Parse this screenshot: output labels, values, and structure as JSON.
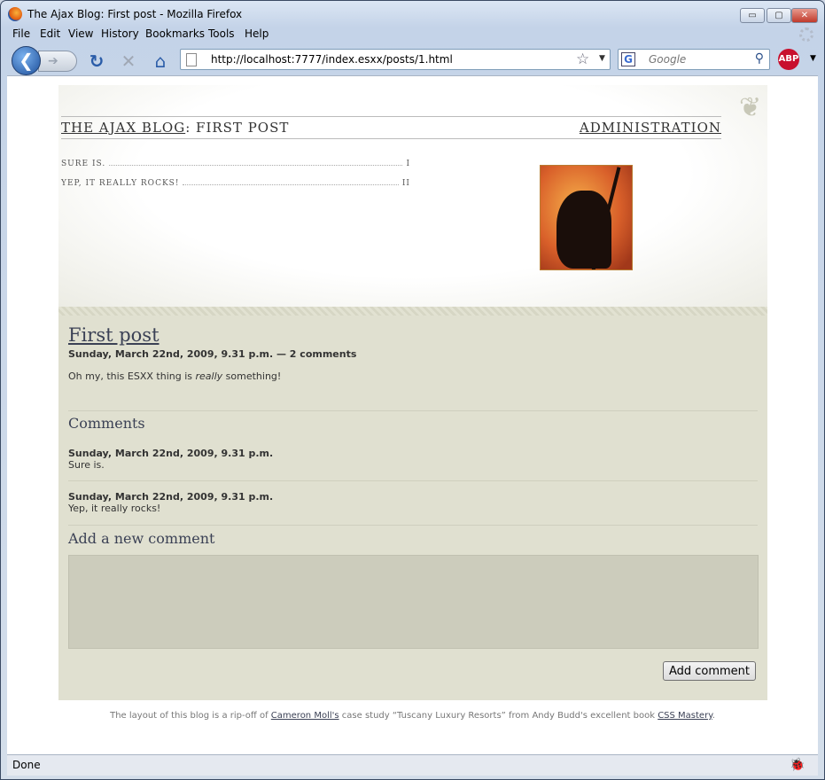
{
  "window": {
    "title": "The Ajax Blog: First post - Mozilla Firefox",
    "controls": {
      "minimize": "▭",
      "maximize": "▢",
      "close": "✕"
    }
  },
  "menu": [
    "File",
    "Edit",
    "View",
    "History",
    "Bookmarks",
    "Tools",
    "Help"
  ],
  "toolbar": {
    "url": "http://localhost:7777/index.esxx/posts/1.html",
    "search_placeholder": "Google",
    "abp_label": "ABP",
    "icons": [
      "back-icon",
      "forward-icon",
      "reload-icon",
      "stop-icon",
      "home-icon",
      "bookmark-star-icon",
      "search-icon"
    ]
  },
  "page": {
    "blog_title": "THE AJAX BLOG",
    "title_sep": ": ",
    "current_section": "FIRST POST",
    "admin_link": "ADMINISTRATION",
    "toc": [
      {
        "label": "SURE IS.",
        "num": "I"
      },
      {
        "label": "YEP, IT REALLY ROCKS!",
        "num": "II"
      }
    ],
    "post": {
      "title": "First post",
      "meta": "Sunday, March 22nd, 2009, 9.31 p.m. — 2 comments",
      "body_before": "Oh my, this ESXX thing is ",
      "body_em": "really",
      "body_after": " something!"
    },
    "comments_heading": "Comments",
    "comments": [
      {
        "date": "Sunday, March 22nd, 2009, 9.31 p.m.",
        "text": "Sure is."
      },
      {
        "date": "Sunday, March 22nd, 2009, 9.31 p.m.",
        "text": "Yep, it really rocks!"
      }
    ],
    "add_heading": "Add a new comment",
    "add_button": "Add comment",
    "footer": {
      "pre": "The layout of this blog is a rip-off of ",
      "link1": "Cameron Moll's",
      "mid": " case study “Tuscany Luxury Resorts” from Andy Budd's excellent book ",
      "link2": "CSS Mastery",
      "post": "."
    }
  },
  "status": {
    "text": "Done"
  }
}
